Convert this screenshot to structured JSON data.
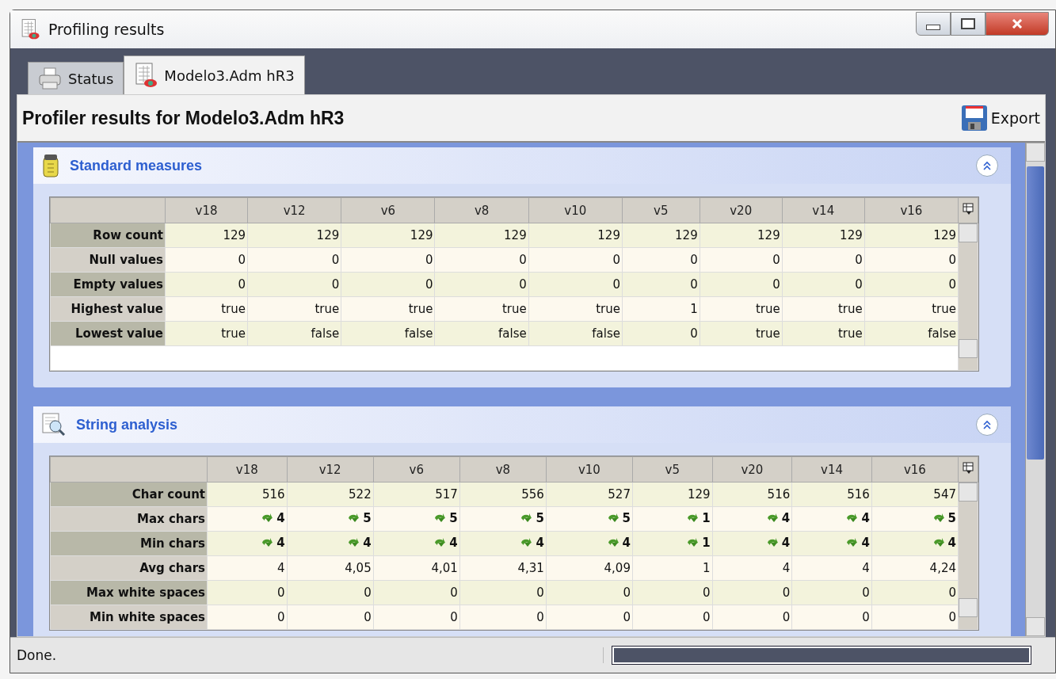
{
  "window": {
    "title": "Profiling results"
  },
  "tabs": [
    {
      "label": "Status",
      "selected": false
    },
    {
      "label": "Modelo3.Adm hR3",
      "selected": true
    }
  ],
  "header": {
    "title": "Profiler results for Modelo3.Adm hR3",
    "export_button": "Export"
  },
  "sections": [
    {
      "title": "Standard measures",
      "expanded": true,
      "table": {
        "columns": [
          "v18",
          "v12",
          "v6",
          "v8",
          "v10",
          "v5",
          "v20",
          "v14",
          "v16"
        ],
        "rows": [
          {
            "label": "Row count",
            "kind": "text",
            "values": [
              "129",
              "129",
              "129",
              "129",
              "129",
              "129",
              "129",
              "129",
              "129"
            ]
          },
          {
            "label": "Null values",
            "kind": "text",
            "values": [
              "0",
              "0",
              "0",
              "0",
              "0",
              "0",
              "0",
              "0",
              "0"
            ]
          },
          {
            "label": "Empty values",
            "kind": "text",
            "values": [
              "0",
              "0",
              "0",
              "0",
              "0",
              "0",
              "0",
              "0",
              "0"
            ]
          },
          {
            "label": "Highest value",
            "kind": "text",
            "values": [
              "true",
              "true",
              "true",
              "true",
              "true",
              "1",
              "true",
              "true",
              "true"
            ]
          },
          {
            "label": "Lowest value",
            "kind": "text",
            "values": [
              "true",
              "false",
              "false",
              "false",
              "false",
              "0",
              "true",
              "true",
              "false"
            ]
          }
        ]
      }
    },
    {
      "title": "String analysis",
      "expanded": true,
      "table": {
        "columns": [
          "v18",
          "v12",
          "v6",
          "v8",
          "v10",
          "v5",
          "v20",
          "v14",
          "v16"
        ],
        "rows": [
          {
            "label": "Char count",
            "kind": "text",
            "values": [
              "516",
              "522",
              "517",
              "556",
              "527",
              "129",
              "516",
              "516",
              "547"
            ]
          },
          {
            "label": "Max chars",
            "kind": "drilldown",
            "values": [
              "4",
              "5",
              "5",
              "5",
              "5",
              "1",
              "4",
              "4",
              "5"
            ]
          },
          {
            "label": "Min chars",
            "kind": "drilldown",
            "values": [
              "4",
              "4",
              "4",
              "4",
              "4",
              "1",
              "4",
              "4",
              "4"
            ]
          },
          {
            "label": "Avg chars",
            "kind": "text",
            "values": [
              "4",
              "4,05",
              "4,01",
              "4,31",
              "4,09",
              "1",
              "4",
              "4",
              "4,24"
            ]
          },
          {
            "label": "Max white spaces",
            "kind": "text",
            "values": [
              "0",
              "0",
              "0",
              "0",
              "0",
              "0",
              "0",
              "0",
              "0"
            ]
          },
          {
            "label": "Min white spaces",
            "kind": "text",
            "values": [
              "0",
              "0",
              "0",
              "0",
              "0",
              "0",
              "0",
              "0",
              "0"
            ]
          }
        ]
      }
    }
  ],
  "status_bar": {
    "text": "Done.",
    "progress": {
      "level": 1
    }
  }
}
